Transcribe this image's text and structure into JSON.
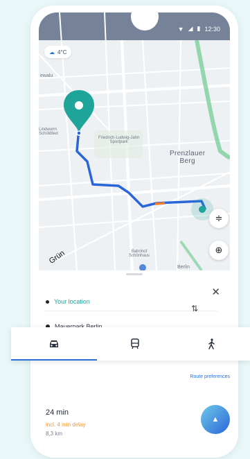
{
  "status": {
    "time": "12:30"
  },
  "map": {
    "location_chip": "4°C",
    "labels": {
      "top_left": "ewalu",
      "district_small": "Lindwurm\nSchüldlied",
      "park": "Friedrich-Ludwig-Jahn\nSportpark",
      "area": "Prenzlauer\nBerg",
      "bottom": "Bahnhof\nSchönhaus",
      "bottom_right": "Berlin",
      "brand": "Grün"
    }
  },
  "route": {
    "from": "Your location",
    "to": "Mauerpark Berlin",
    "preferences_label": "Route preferences",
    "duration": "24 min",
    "delay": "incl. 4 min delay",
    "distance": "8,3 km"
  },
  "tabs": [
    {
      "name": "tab-car",
      "icon": "car-icon",
      "active": true
    },
    {
      "name": "tab-transit",
      "icon": "transit-icon",
      "active": false
    },
    {
      "name": "tab-walk",
      "icon": "walk-icon",
      "active": false
    }
  ],
  "colors": {
    "route": "#2a66d9",
    "traffic": "#f07a2a",
    "pin": "#1fa49a",
    "park": "#7ccf9b",
    "accent": "#2a6fd6"
  }
}
